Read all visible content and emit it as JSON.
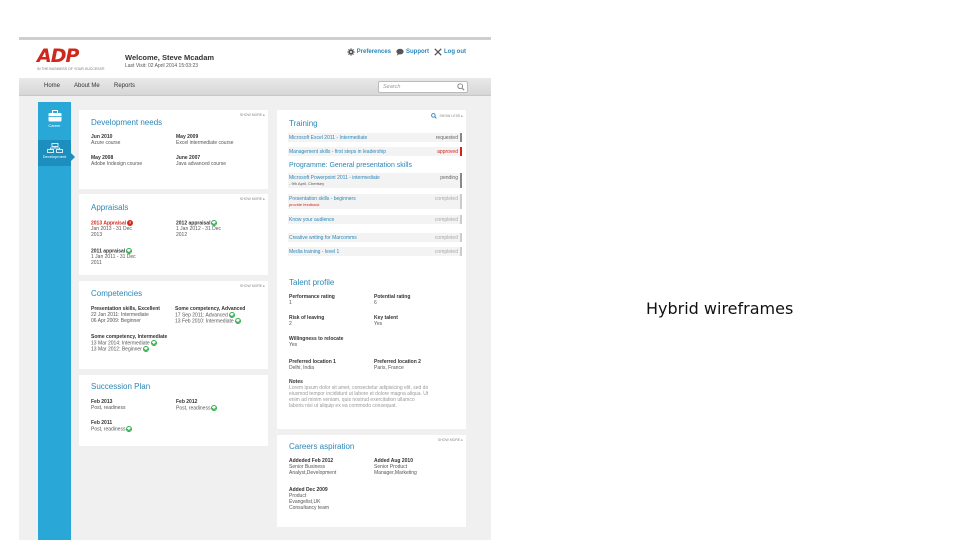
{
  "header": {
    "logo": "ADP",
    "tagline": "IN THE BUSINESS OF YOUR SUCCESS®",
    "welcome": "Welcome, Steve Mcadam",
    "last_visit": "Last Visit: 02 April 2014 15:03:23",
    "preferences": "Preferences",
    "support": "Support",
    "logout": "Log out"
  },
  "nav": {
    "home": "Home",
    "about": "About Me",
    "reports": "Reports",
    "search_placeholder": "Search"
  },
  "sidebar": {
    "career": "Career",
    "development": "Development"
  },
  "dev_needs": {
    "title": "Development needs",
    "show_more": "SHOW MORE ▸",
    "items": [
      {
        "date": "Jun 2010",
        "text": "Azure course"
      },
      {
        "date": "May 2009",
        "text": "Excel intermediate course"
      },
      {
        "date": "May 2008",
        "text": "Adobe Indesign course"
      },
      {
        "date": "June 2007",
        "text": "Java advanced course"
      }
    ]
  },
  "appraisals": {
    "title": "Appraisals",
    "show_more": "SHOW MORE ▸",
    "a2013": {
      "label": "2013 Appraisal",
      "range1": "Jan 2013 - 31 Dec",
      "range2": "2013"
    },
    "a2012": {
      "label": "2012 appraisal",
      "range1": "1 Jan 2012 - 31 Dec",
      "range2": "2012"
    },
    "a2011": {
      "label": "2011 appraisal",
      "range1": "1 Jan 2011 - 31 Dec",
      "range2": "2011"
    }
  },
  "competencies": {
    "title": "Competencies",
    "show_more": "SHOW MORE ▸",
    "c1": {
      "name": "Presentation skills, Excellent",
      "l1": "22 Jan 2011: Intermediate",
      "l2": "06 Apr 2009: Beginner"
    },
    "c2": {
      "name": "Some competency, Advanced",
      "l1": "17 Sep 2011: Advanced",
      "l2": "13 Feb 2010: Intermediate"
    },
    "c3": {
      "name": "Some competency, Intermediate",
      "l1": "13 Mar 2014: Intermediate",
      "l2": "13 Mar 2012: Beginner"
    }
  },
  "succession": {
    "title": "Succession Plan",
    "s1": {
      "date": "Feb 2013",
      "text": "Post, readiness"
    },
    "s2": {
      "date": "Feb 2012",
      "text": "Post, readiness"
    },
    "s3": {
      "date": "Feb 2011",
      "text": "Post, readiness"
    }
  },
  "training": {
    "title": "Training",
    "show_less": "SHOW LESS ▸",
    "programme_title": "Programme: General presentation skills",
    "rows": [
      {
        "label": "Microsoft Excel 2011 - Intermediate",
        "status": "requested"
      },
      {
        "label": "Management skills - first steps in leadership",
        "status": "approved"
      },
      {
        "label": "Microsoft Powerpoint 2011 - intermediate",
        "status": "pending",
        "sub": "- 9th April, Chertsey"
      },
      {
        "label": "Presentation skills - beginners",
        "status": "completed",
        "sub": "provide feedback"
      },
      {
        "label": "Know your audience",
        "status": "completed"
      },
      {
        "label": "Creative writing for Marcomms",
        "status": "completed"
      },
      {
        "label": "Media training - level 1",
        "status": "completed"
      }
    ]
  },
  "talent": {
    "title": "Talent profile",
    "perf_label": "Performance rating",
    "perf_val": "1",
    "pot_label": "Potential rating",
    "pot_val": "6",
    "risk_label": "Risk of leaving",
    "risk_val": "2",
    "key_label": "Key talent",
    "key_val": "Yes",
    "reloc_label": "Willingness to relocate",
    "reloc_val": "Yes",
    "loc1_label": "Preferred location 1",
    "loc1_val": "Delhi, India",
    "loc2_label": "Preferred location 2",
    "loc2_val": "Paris, France",
    "notes_label": "Notes",
    "notes_l1": "Lorem ipsum dolor sit amet, consectetur adipisicing elit, sed do",
    "notes_l2": "eiusmod tempor incididunt ut labore et dolore magna aliqua. Ut",
    "notes_l3": "enim ad minim veniam, quis nostrud exercitation ullamco",
    "notes_l4": "laboris nisi ut aliquip ex ea commodo consequat."
  },
  "careers": {
    "title": "Careers aspiration",
    "show_more": "SHOW MORE ▸",
    "a1": {
      "date": "Addeded Feb 2012",
      "l1": "Senior Business",
      "l2": "Analyst,Development"
    },
    "a2": {
      "date": "Added Aug 2010",
      "l1": "Senior Product",
      "l2": "Manager,Marketing"
    },
    "a3": {
      "date": "Added Dec 2009",
      "l1": "Product",
      "l2": "Evangelist,UK",
      "l3": "Consultancy team"
    }
  },
  "caption": "Hybrid wireframes",
  "colors": {
    "accent": "#2a87b8",
    "sidebar": "#29a8d8",
    "brand_red": "#d0271d",
    "ok_green": "#2fae4a"
  }
}
